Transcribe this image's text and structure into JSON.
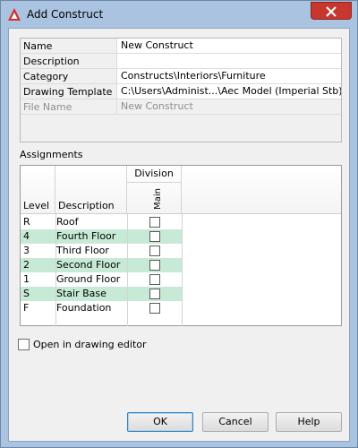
{
  "window": {
    "title": "Add Construct",
    "close_label": "×"
  },
  "properties": [
    {
      "name": "Name",
      "value": "New Construct",
      "disabled": false
    },
    {
      "name": "Description",
      "value": "",
      "disabled": false
    },
    {
      "name": "Category",
      "value": "Constructs\\Interiors\\Furniture",
      "disabled": false
    },
    {
      "name": "Drawing Template",
      "value": "C:\\Users\\Administ...\\Aec Model (Imperial Stb).dwt",
      "disabled": false
    },
    {
      "name": "File Name",
      "value": "New Construct",
      "disabled": true
    }
  ],
  "assignments": {
    "label": "Assignments",
    "headers": {
      "level": "Level",
      "description": "Description",
      "division": "Division",
      "main": "Main"
    },
    "rows": [
      {
        "level": "R",
        "description": "Roof",
        "checked": false
      },
      {
        "level": "4",
        "description": "Fourth Floor",
        "checked": false
      },
      {
        "level": "3",
        "description": "Third Floor",
        "checked": false
      },
      {
        "level": "2",
        "description": "Second Floor",
        "checked": false
      },
      {
        "level": "1",
        "description": "Ground Floor",
        "checked": false
      },
      {
        "level": "S",
        "description": "Stair Base",
        "checked": false
      },
      {
        "level": "F",
        "description": "Foundation",
        "checked": false
      }
    ]
  },
  "open_in_editor": {
    "label": "Open in drawing editor",
    "checked": false
  },
  "buttons": {
    "ok": "OK",
    "cancel": "Cancel",
    "help": "Help"
  },
  "colors": {
    "title_bar": "#aac3e0",
    "close_button": "#c7372e",
    "alt_row": "#c6ead6",
    "app_icon": "#d32f2f"
  }
}
